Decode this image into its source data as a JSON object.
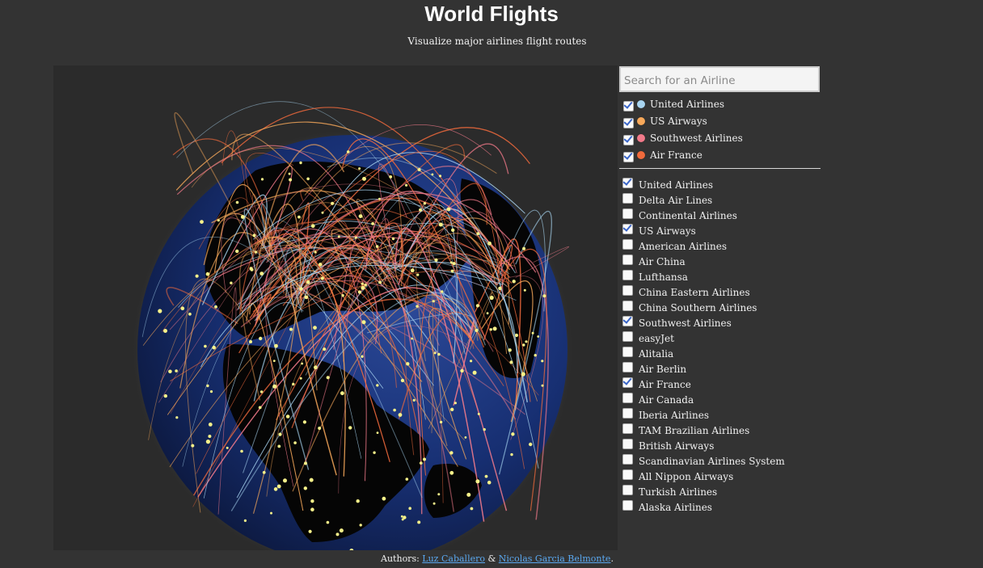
{
  "header": {
    "title": "World Flights",
    "subtitle": "Visualize major airlines flight routes"
  },
  "search": {
    "placeholder": "Search for an Airline",
    "value": ""
  },
  "selected_airlines": [
    {
      "label": "United Airlines",
      "color": "#a8d4f0",
      "checked": true
    },
    {
      "label": "US Airways",
      "color": "#f7a85a",
      "checked": true
    },
    {
      "label": "Southwest Airlines",
      "color": "#f27a8a",
      "checked": true
    },
    {
      "label": "Air France",
      "color": "#f06a3c",
      "checked": true
    }
  ],
  "airlines": [
    {
      "label": "United Airlines",
      "checked": true
    },
    {
      "label": "Delta Air Lines",
      "checked": false
    },
    {
      "label": "Continental Airlines",
      "checked": false
    },
    {
      "label": "US Airways",
      "checked": true
    },
    {
      "label": "American Airlines",
      "checked": false
    },
    {
      "label": "Air China",
      "checked": false
    },
    {
      "label": "Lufthansa",
      "checked": false
    },
    {
      "label": "China Eastern Airlines",
      "checked": false
    },
    {
      "label": "China Southern Airlines",
      "checked": false
    },
    {
      "label": "Southwest Airlines",
      "checked": true
    },
    {
      "label": "easyJet",
      "checked": false
    },
    {
      "label": "Alitalia",
      "checked": false
    },
    {
      "label": "Air Berlin",
      "checked": false
    },
    {
      "label": "Air France",
      "checked": true
    },
    {
      "label": "Air Canada",
      "checked": false
    },
    {
      "label": "Iberia Airlines",
      "checked": false
    },
    {
      "label": "TAM Brazilian Airlines",
      "checked": false
    },
    {
      "label": "British Airways",
      "checked": false
    },
    {
      "label": "Scandinavian Airlines System",
      "checked": false
    },
    {
      "label": "All Nippon Airways",
      "checked": false
    },
    {
      "label": "Turkish Airlines",
      "checked": false
    },
    {
      "label": "Alaska Airlines",
      "checked": false
    }
  ],
  "footer": {
    "prefix": "Authors: ",
    "author1": "Luz Caballero",
    "separator": " & ",
    "author2": "Nicolas Garcia Belmonte",
    "suffix": "."
  }
}
